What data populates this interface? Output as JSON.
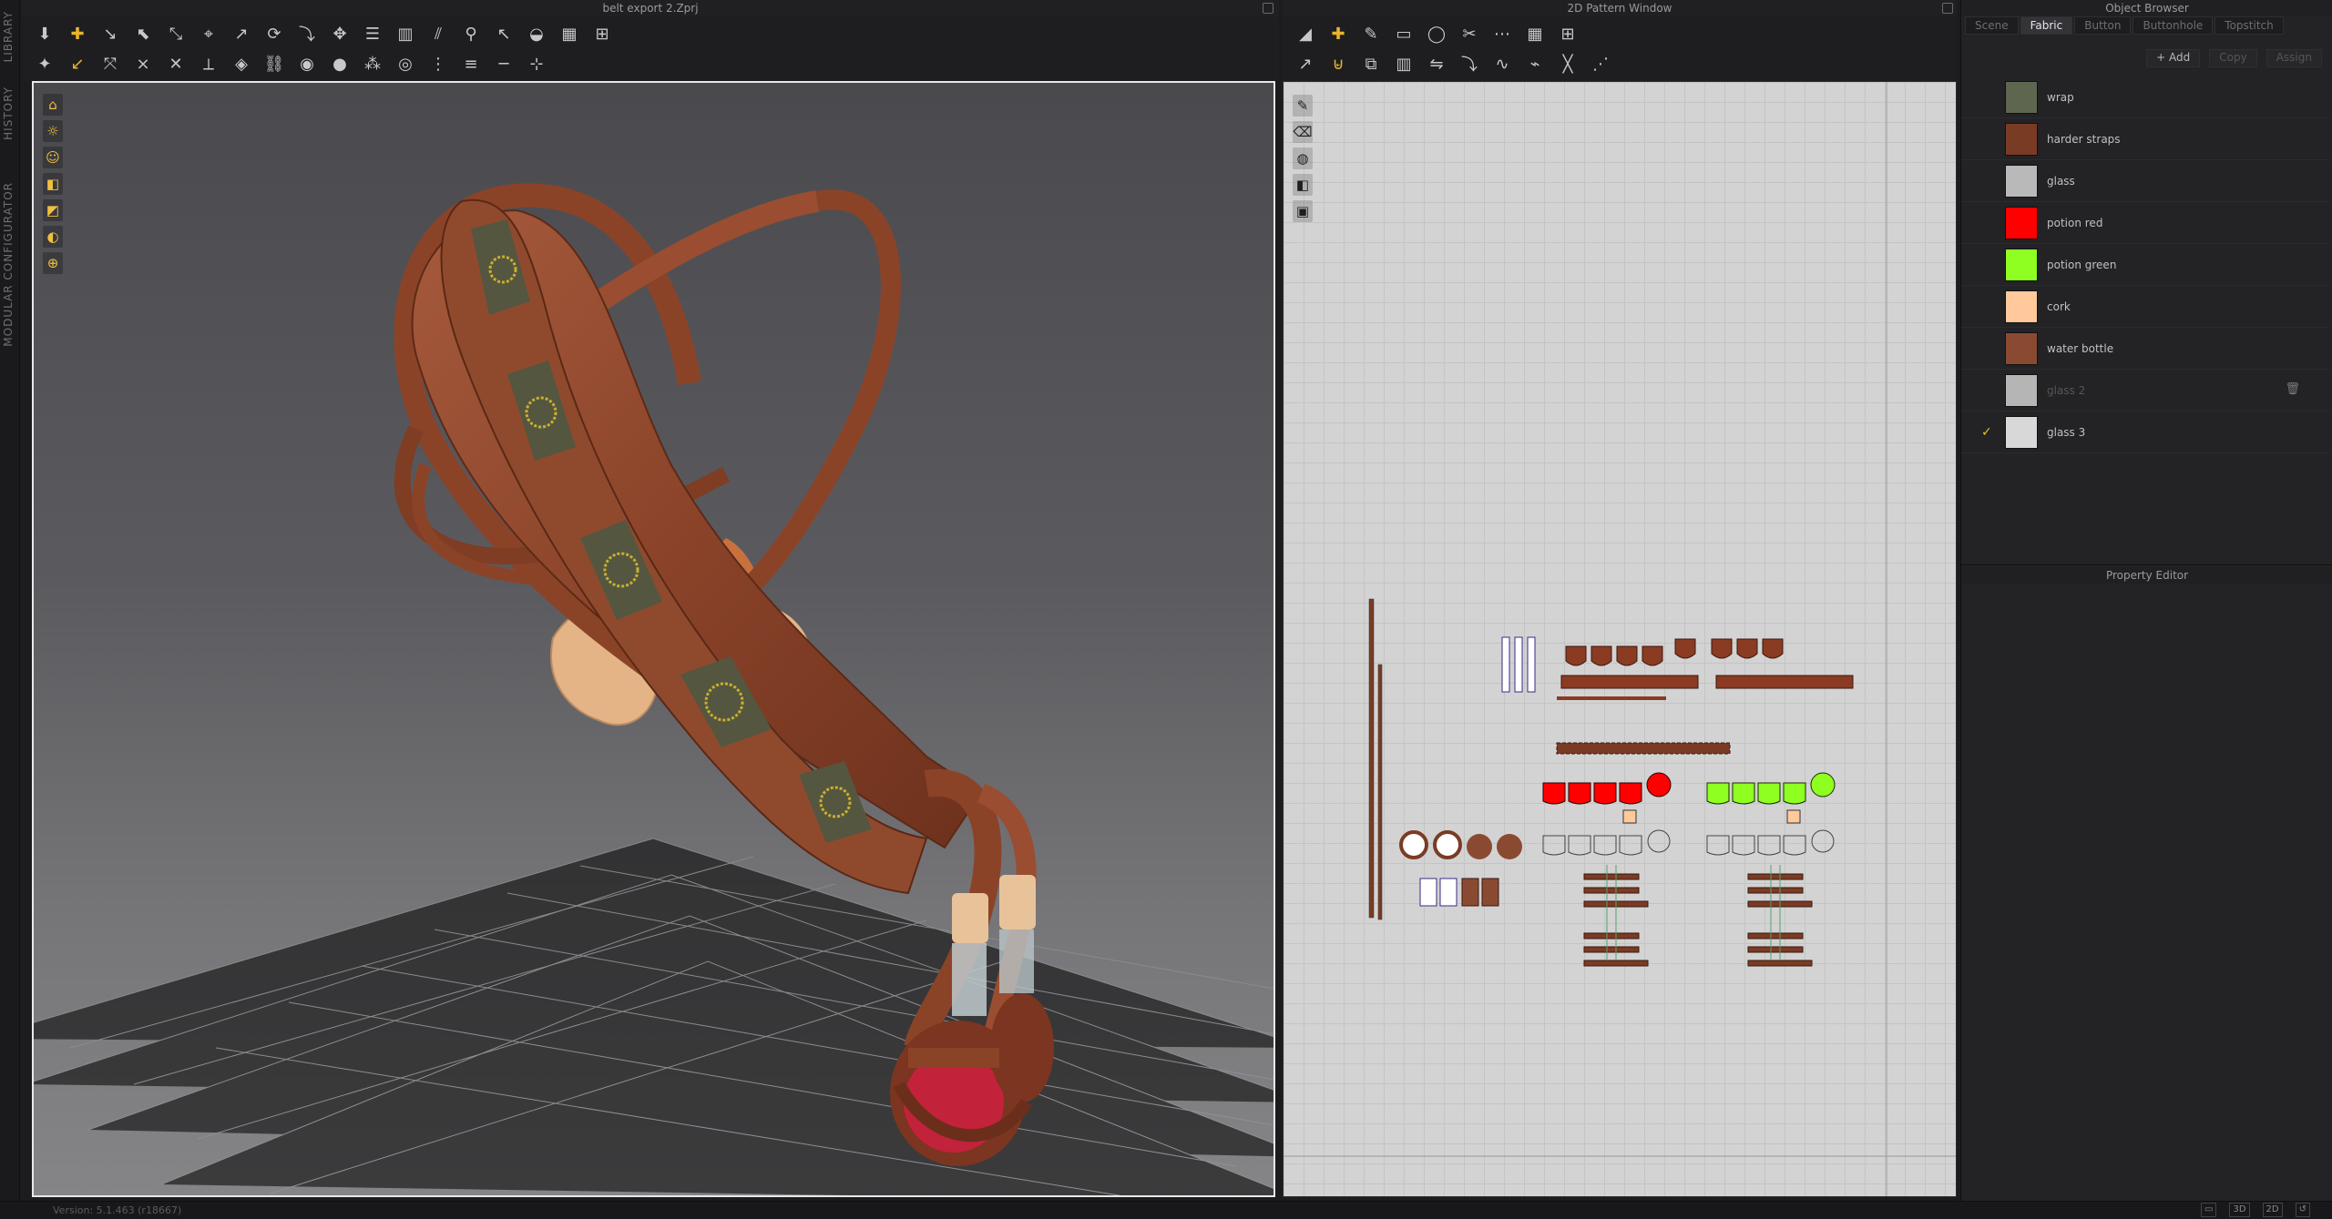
{
  "left_tabs": [
    "LIBRARY",
    "HISTORY",
    "MODULAR CONFIGURATOR"
  ],
  "viewport_3d": {
    "title": "belt export 2.Zprj",
    "toolbar_row1": [
      "move-down-icon",
      "add-point-icon",
      "edit-line-icon",
      "select-icon",
      "transform-icon",
      "snap-icon",
      "segment-icon",
      "sewing-icon",
      "fold-icon",
      "gizmo-icon",
      "cloth-icon",
      "arrange-icon",
      "split-icon",
      "pin-icon",
      "needle-icon",
      "cup-icon",
      "grid-small-icon",
      "grid-large-icon"
    ],
    "toolbar_row2": [
      "figure-icon",
      "fold-arrow-icon",
      "unfold-icon",
      "tack-icon",
      "tack-x-icon",
      "measure-icon",
      "rivet-icon",
      "chain-icon",
      "button-icon",
      "dot-icon",
      "cluster-icon",
      "ring-icon",
      "zip-icon",
      "tape-icon",
      "line-icon",
      "split-line-icon"
    ],
    "side_tools": [
      "shirt-icon",
      "sun-icon",
      "avatar-icon",
      "texture-icon",
      "shade-icon",
      "skin-icon",
      "globe-icon"
    ]
  },
  "pattern_window": {
    "title": "2D Pattern Window",
    "toolbar_row1": [
      "trace-icon",
      "add-point-icon",
      "pen-icon",
      "rectangle-icon",
      "ellipse-icon",
      "cut-icon",
      "internal-line-icon",
      "grid-small-icon",
      "grid-large-icon"
    ],
    "toolbar_row2": [
      "segment-icon",
      "merge-icon",
      "offset-icon",
      "arrange-icon",
      "mirror-icon",
      "fold-icon",
      "sew-icon",
      "trim-icon",
      "seam-icon",
      "stitch-icon"
    ],
    "side_tools": [
      "pen-icon",
      "eraser-icon",
      "spool-icon",
      "texture-icon",
      "stamp-icon"
    ]
  },
  "object_browser": {
    "title": "Object Browser",
    "tabs": [
      "Scene",
      "Fabric",
      "Button",
      "Buttonhole",
      "Topstitch"
    ],
    "active_tab": "Fabric",
    "actions": {
      "add": "+ Add",
      "copy": "Copy",
      "assign": "Assign"
    },
    "fabrics": [
      {
        "name": "wrap",
        "color": "#5e6650",
        "checked": false,
        "dim": false
      },
      {
        "name": "harder straps",
        "color": "#7a3b25",
        "checked": false,
        "dim": false
      },
      {
        "name": "glass",
        "color": "#b9b9b9",
        "checked": false,
        "dim": false
      },
      {
        "name": "potion red",
        "color": "#ff0000",
        "checked": false,
        "dim": false
      },
      {
        "name": "potion green",
        "color": "#8fff22",
        "checked": false,
        "dim": false
      },
      {
        "name": "cork",
        "color": "#ffc99c",
        "checked": false,
        "dim": false
      },
      {
        "name": "water bottle",
        "color": "#8a4a32",
        "checked": false,
        "dim": false
      },
      {
        "name": "glass 2",
        "color": "#b5b5b5",
        "checked": false,
        "dim": true
      },
      {
        "name": "glass 3",
        "color": "#d8d8d8",
        "checked": true,
        "dim": false
      }
    ]
  },
  "property_editor": {
    "title": "Property Editor"
  },
  "status_bar": {
    "version": "Version: 5.1.463 (r18667)",
    "view_modes": [
      "▭",
      "3D",
      "2D",
      "↺"
    ]
  }
}
